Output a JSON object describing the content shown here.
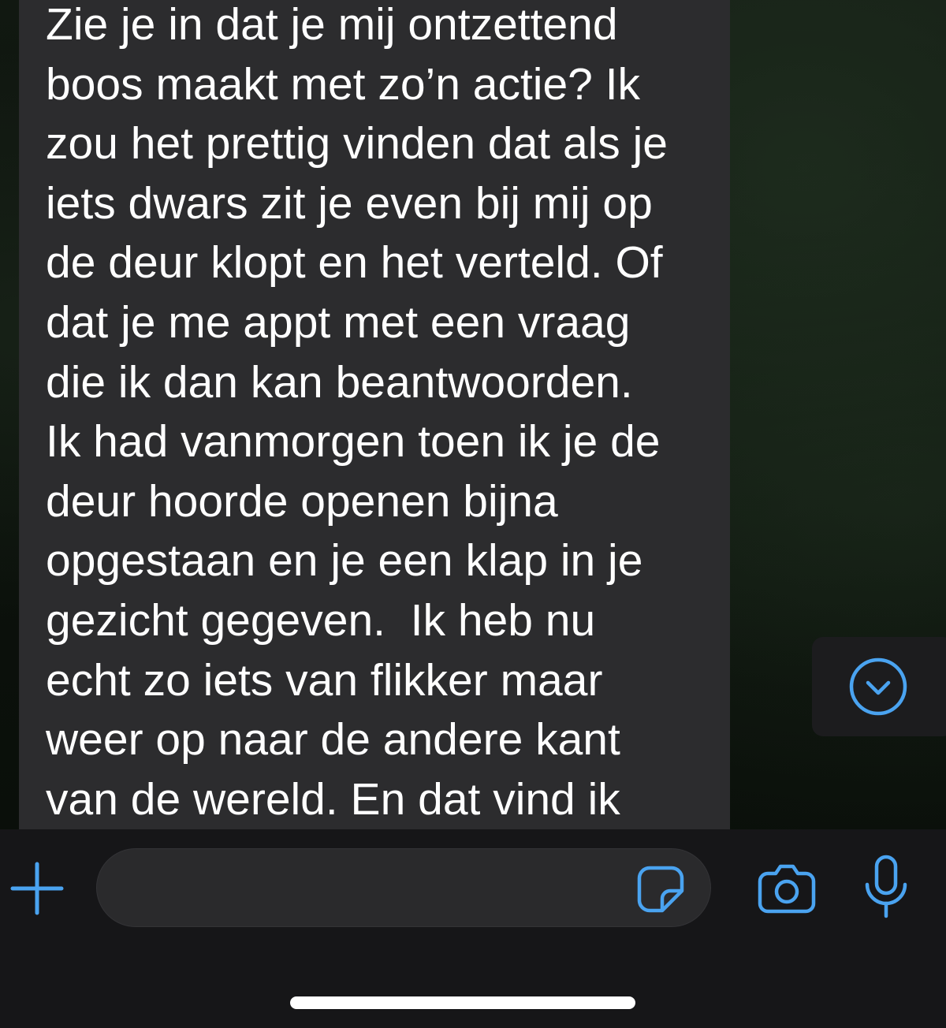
{
  "message": {
    "text": "Zie je in dat je mij ontzettend\nboos maakt met zo’n actie? Ik\nzou het prettig vinden dat als je\niets dwars zit je even bij mij op\nde deur klopt en het verteld. Of\ndat je me appt met een vraag\ndie ik dan kan beantwoorden.\nIk had vanmorgen toen ik je de\ndeur hoorde openen bijna\nopgestaan en je een klap in je\ngezicht gegeven.  Ik heb nu\necht zo iets van flikker maar\nweer op naar de andere kant\nvan de wereld. En dat vind ik"
  },
  "composer": {
    "input_value": "",
    "input_placeholder": ""
  },
  "icons": {
    "attach": "plus-icon",
    "sticker": "sticker-icon",
    "camera": "camera-icon",
    "microphone": "microphone-icon",
    "scroll_down": "chevron-down-circle-icon"
  },
  "colors": {
    "accent": "#4aa3f0",
    "bubble": "#2c2c2e",
    "bar": "#161618"
  }
}
